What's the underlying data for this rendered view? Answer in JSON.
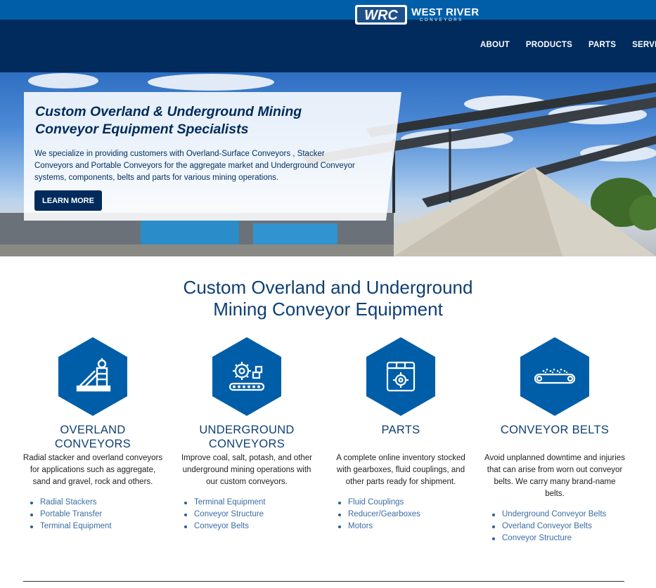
{
  "header": {
    "logo_mark": "WRC",
    "logo_name": "WEST RIVER",
    "logo_sub": "CONVEYORS",
    "nav": [
      {
        "label": "ABOUT"
      },
      {
        "label": "PRODUCTS"
      },
      {
        "label": "PARTS"
      },
      {
        "label": "SERVICES"
      }
    ]
  },
  "hero": {
    "title": "Custom Overland & Underground Mining Conveyor Equipment Specialists",
    "text": "We specialize in providing customers with Overland-Surface Conveyors , Stacker Conveyors and Portable Conveyors for the aggregate market and Underground Conveyor systems, components, belts and parts for various mining operations.",
    "button_label": "LEARN MORE"
  },
  "main": {
    "title_line1": "Custom Overland and Underground",
    "title_line2": "Mining Conveyor Equipment",
    "cards": [
      {
        "icon": "mine-headframe-icon",
        "title_line1": "OVERLAND",
        "title_line2": "CONVEYORS",
        "desc": "Radial stacker and overland conveyors for applications such as aggregate, sand and gravel, rock and others.",
        "links": [
          "Radial Stackers",
          "Portable Transfer",
          "Terminal Equipment"
        ]
      },
      {
        "icon": "gear-conveyor-icon",
        "title_line1": "UNDERGROUND",
        "title_line2": "CONVEYORS",
        "desc": "Improve coal, salt, potash, and other underground mining operations with our custom conveyors.",
        "links": [
          "Terminal Equipment",
          "Conveyor Structure",
          "Conveyor Belts"
        ]
      },
      {
        "icon": "parts-box-icon",
        "title_line1": "PARTS",
        "title_line2": "",
        "desc": "A complete online inventory stocked with gearboxes, fluid couplings, and other parts ready for shipment.",
        "links": [
          "Fluid Couplings",
          "Reducer/Gearboxes",
          "Motors"
        ]
      },
      {
        "icon": "conveyor-belt-icon",
        "title_line1": "CONVEYOR BELTS",
        "title_line2": "",
        "desc": "Avoid unplanned downtime and injuries that can arise from worn out conveyor belts. We carry many brand-name belts.",
        "links": [
          "Underground Conveyor Belts",
          "Overland Conveyor Belts",
          "Conveyor Structure"
        ]
      }
    ]
  },
  "colors": {
    "topbar": "#005ea8",
    "navbar": "#002b5c",
    "accent": "#005ea8",
    "heading": "#0e3f73",
    "link": "#3a6da3"
  }
}
